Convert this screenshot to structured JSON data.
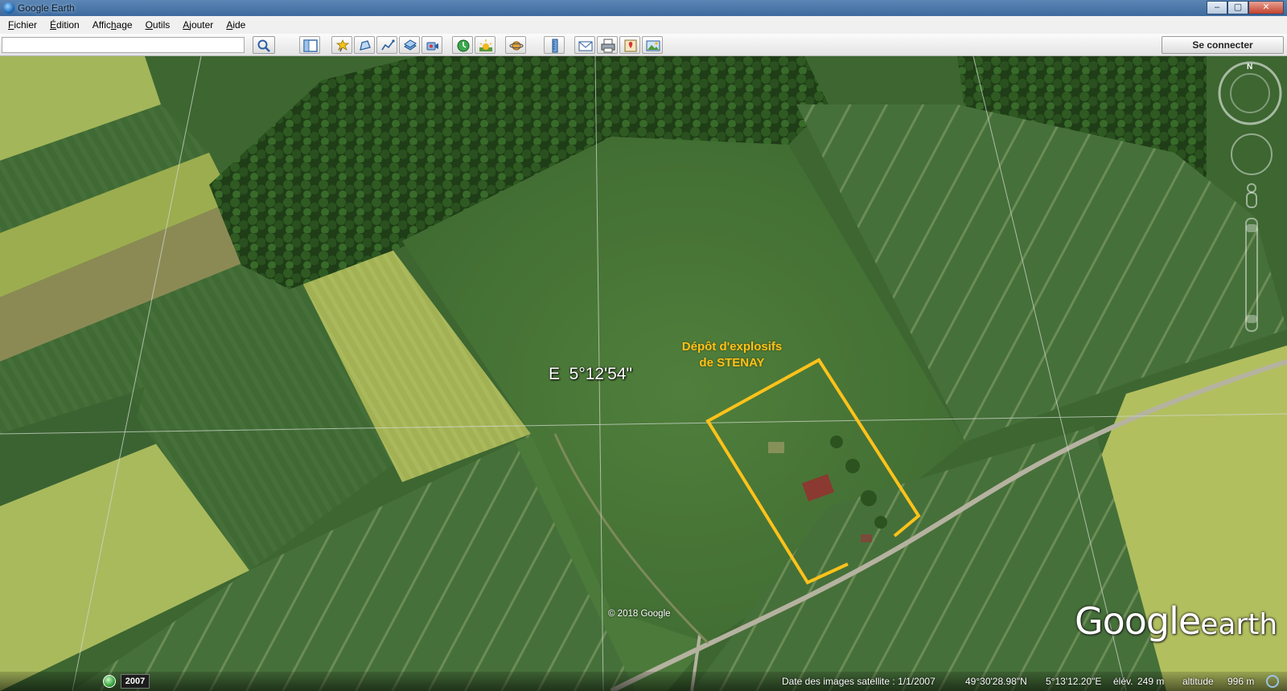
{
  "window": {
    "title": "Google Earth",
    "buttons": {
      "minimize": "–",
      "maximize": "▢",
      "close": "✕"
    }
  },
  "menu": [
    {
      "pre": "",
      "key": "F",
      "rest": "ichier"
    },
    {
      "pre": "",
      "key": "É",
      "rest": "dition"
    },
    {
      "pre": "Affic",
      "key": "h",
      "rest": "age"
    },
    {
      "pre": "",
      "key": "O",
      "rest": "utils"
    },
    {
      "pre": "",
      "key": "A",
      "rest": "jouter"
    },
    {
      "pre": "",
      "key": "A",
      "rest": "ide"
    }
  ],
  "toolbar": {
    "search_value": "",
    "search_icon": "magnifier-icon",
    "signin_label": "Se connecter",
    "tools": [
      "sidebar-icon",
      "placemark-icon",
      "polygon-icon",
      "path-icon",
      "image-overlay-icon",
      "record-tour-icon",
      "historical-imagery-icon",
      "sunlight-icon",
      "planets-icon",
      "ruler-icon",
      "email-icon",
      "print-icon",
      "view-in-maps-icon",
      "save-image-icon"
    ]
  },
  "map": {
    "coord_label": "E  5°12'54\"",
    "annotation_line1": "Dépôt d'explosifs",
    "annotation_line2": "de STENAY",
    "annotation_color": "#ffc21a",
    "copyright": "© 2018 Google",
    "logo_google": "Google",
    "logo_earth": "earth",
    "compass_north": "N"
  },
  "status": {
    "year": "2007",
    "imagery_date": "Date des images satellite : 1/1/2007",
    "latitude": "49°30'28.98\"N",
    "longitude": "5°13'12.20\"E",
    "elev_label": "élév.",
    "elevation": "249 m",
    "altitude_label": "altitude",
    "altitude": "996 m"
  }
}
